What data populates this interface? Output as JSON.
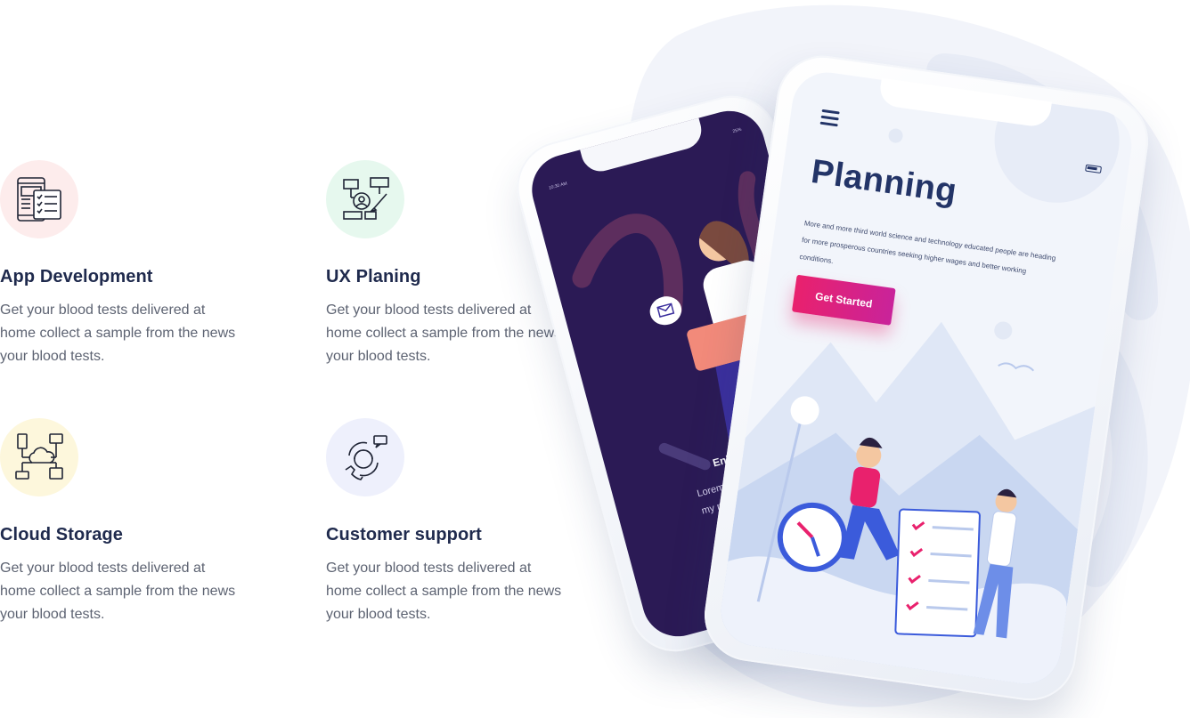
{
  "features": [
    {
      "title": "App Development",
      "description": "Get your blood tests delivered at home collect a sample from the news your blood tests.",
      "icon": "app-development-icon",
      "bg": "#fdecec"
    },
    {
      "title": "UX Planing",
      "description": "Get your blood tests delivered at home collect a sample from the news your blood tests.",
      "icon": "ux-planning-icon",
      "bg": "#e6f8ee"
    },
    {
      "title": "Cloud Storage",
      "description": "Get your blood tests delivered at home collect a sample from the news your blood tests.",
      "icon": "cloud-storage-icon",
      "bg": "#fdf7dc"
    },
    {
      "title": "Customer support",
      "description": "Get your blood tests delivered at home collect a sample from the news your blood tests.",
      "icon": "customer-support-icon",
      "bg": "#eef0fc"
    }
  ],
  "phone_front": {
    "title": "Planning",
    "text": "More and more third world science and technology educated people are heading for more prosperous countries seeking higher wages and better working conditions.",
    "button": "Get Started",
    "accent": "#e9216d"
  },
  "phone_back": {
    "status_time": "10:30 AM",
    "status_right": "25%",
    "title": "Enhance P",
    "text": "Lorem ipsum do tuer adipiscin my nib",
    "bg": "#2b1a55"
  }
}
